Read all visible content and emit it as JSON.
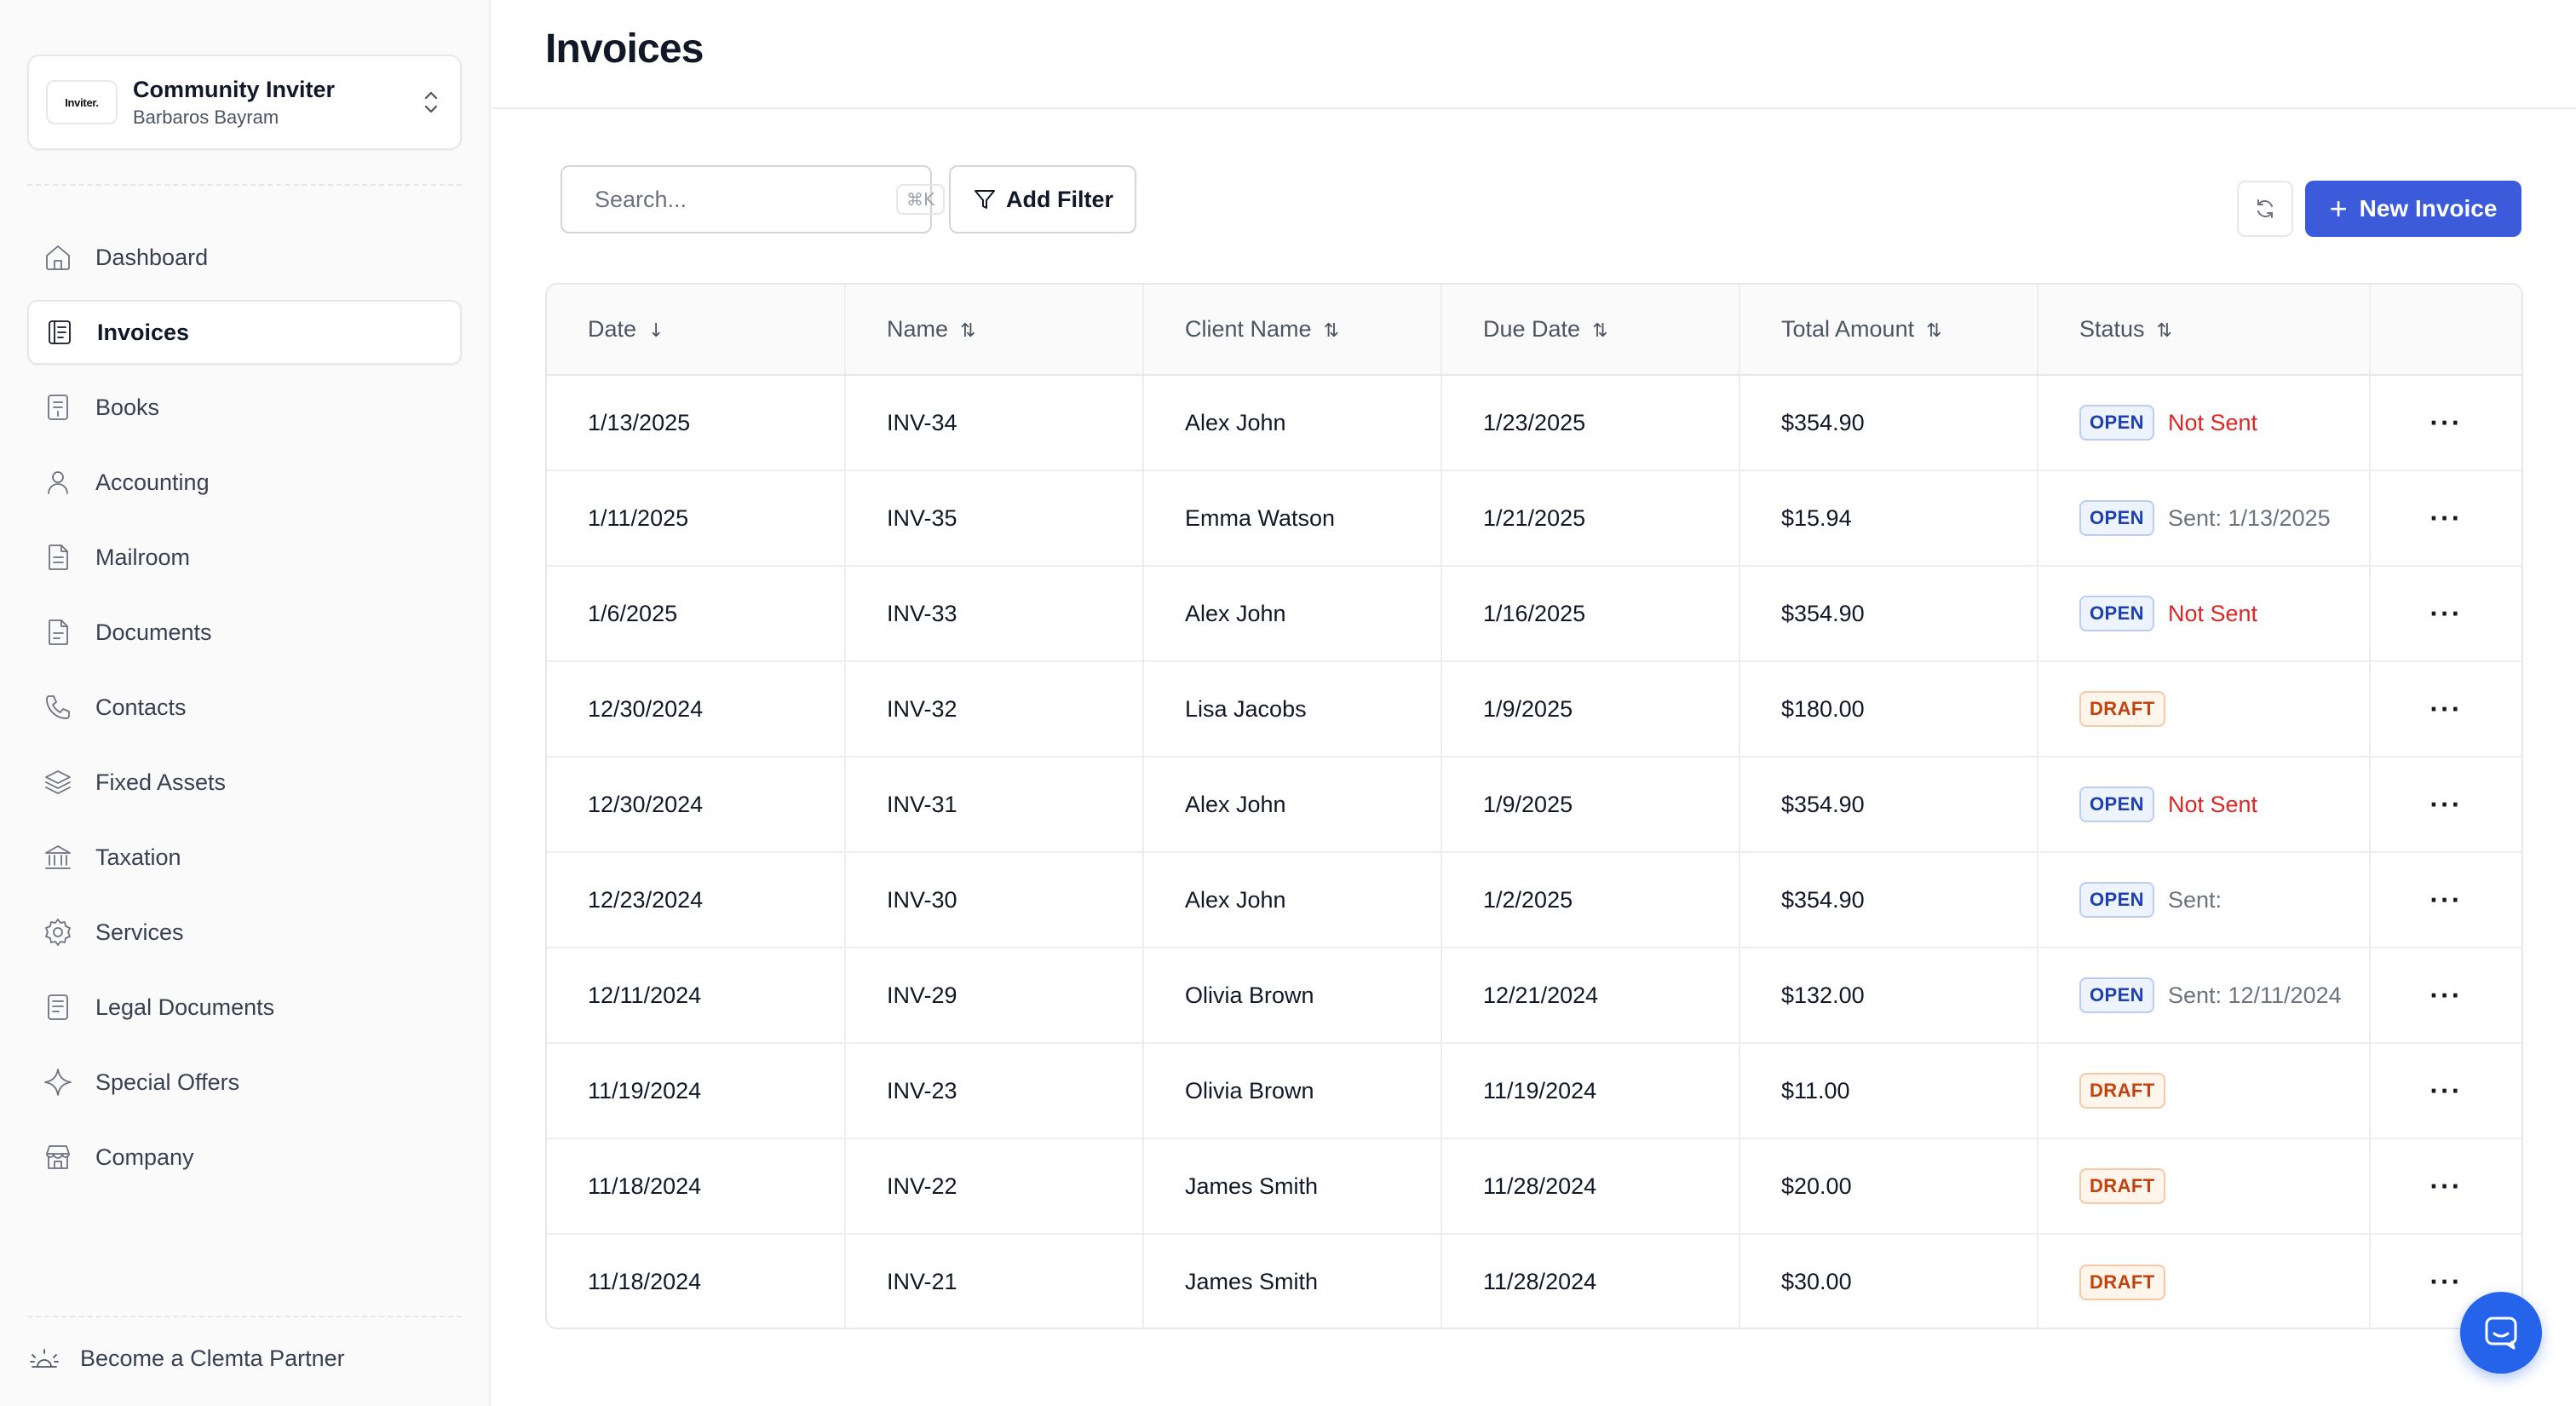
{
  "org": {
    "logo_text": "Inviter.",
    "name": "Community Inviter",
    "user": "Barbaros Bayram"
  },
  "nav": [
    {
      "label": "Dashboard",
      "icon": "home-icon",
      "active": false
    },
    {
      "label": "Invoices",
      "icon": "invoice-icon",
      "active": true
    },
    {
      "label": "Books",
      "icon": "book-icon",
      "active": false
    },
    {
      "label": "Accounting",
      "icon": "user-icon",
      "active": false
    },
    {
      "label": "Mailroom",
      "icon": "file-icon",
      "active": false
    },
    {
      "label": "Documents",
      "icon": "document-icon",
      "active": false
    },
    {
      "label": "Contacts",
      "icon": "phone-icon",
      "active": false
    },
    {
      "label": "Fixed Assets",
      "icon": "layers-icon",
      "active": false
    },
    {
      "label": "Taxation",
      "icon": "bank-icon",
      "active": false
    },
    {
      "label": "Services",
      "icon": "gear-icon",
      "active": false
    },
    {
      "label": "Legal Documents",
      "icon": "legal-doc-icon",
      "active": false
    },
    {
      "label": "Special Offers",
      "icon": "sparkle-icon",
      "active": false
    },
    {
      "label": "Company",
      "icon": "store-icon",
      "active": false
    }
  ],
  "partner_label": "Become a Clemta Partner",
  "page_title": "Invoices",
  "search": {
    "placeholder": "Search...",
    "shortcut": "⌘K"
  },
  "add_filter_label": "Add Filter",
  "new_invoice_label": "New Invoice",
  "table": {
    "columns": [
      {
        "label": "Date",
        "sort": "↓"
      },
      {
        "label": "Name",
        "sort": "⇅"
      },
      {
        "label": "Client Name",
        "sort": "⇅"
      },
      {
        "label": "Due Date",
        "sort": "⇅"
      },
      {
        "label": "Total Amount",
        "sort": "⇅"
      },
      {
        "label": "Status",
        "sort": "⇅"
      }
    ],
    "rows": [
      {
        "date": "1/13/2025",
        "name": "INV-34",
        "client": "Alex John",
        "due": "1/23/2025",
        "amount": "$354.90",
        "status": "OPEN",
        "sent": "Not Sent"
      },
      {
        "date": "1/11/2025",
        "name": "INV-35",
        "client": "Emma Watson",
        "due": "1/21/2025",
        "amount": "$15.94",
        "status": "OPEN",
        "sent": "Sent: 1/13/2025"
      },
      {
        "date": "1/6/2025",
        "name": "INV-33",
        "client": "Alex John",
        "due": "1/16/2025",
        "amount": "$354.90",
        "status": "OPEN",
        "sent": "Not Sent"
      },
      {
        "date": "12/30/2024",
        "name": "INV-32",
        "client": "Lisa Jacobs",
        "due": "1/9/2025",
        "amount": "$180.00",
        "status": "DRAFT",
        "sent": ""
      },
      {
        "date": "12/30/2024",
        "name": "INV-31",
        "client": "Alex John",
        "due": "1/9/2025",
        "amount": "$354.90",
        "status": "OPEN",
        "sent": "Not Sent"
      },
      {
        "date": "12/23/2024",
        "name": "INV-30",
        "client": "Alex John",
        "due": "1/2/2025",
        "amount": "$354.90",
        "status": "OPEN",
        "sent": "Sent:"
      },
      {
        "date": "12/11/2024",
        "name": "INV-29",
        "client": "Olivia Brown",
        "due": "12/21/2024",
        "amount": "$132.00",
        "status": "OPEN",
        "sent": "Sent: 12/11/2024"
      },
      {
        "date": "11/19/2024",
        "name": "INV-23",
        "client": "Olivia Brown",
        "due": "11/19/2024",
        "amount": "$11.00",
        "status": "DRAFT",
        "sent": ""
      },
      {
        "date": "11/18/2024",
        "name": "INV-22",
        "client": "James Smith",
        "due": "11/28/2024",
        "amount": "$20.00",
        "status": "DRAFT",
        "sent": ""
      },
      {
        "date": "11/18/2024",
        "name": "INV-21",
        "client": "James Smith",
        "due": "11/28/2024",
        "amount": "$30.00",
        "status": "DRAFT",
        "sent": ""
      }
    ],
    "row_action": "···"
  },
  "colors": {
    "accent": "#3b5bdb",
    "open_badge": "#1e40af",
    "draft_badge": "#c2410c",
    "not_sent": "#dc2626",
    "chat": "#2563eb"
  }
}
